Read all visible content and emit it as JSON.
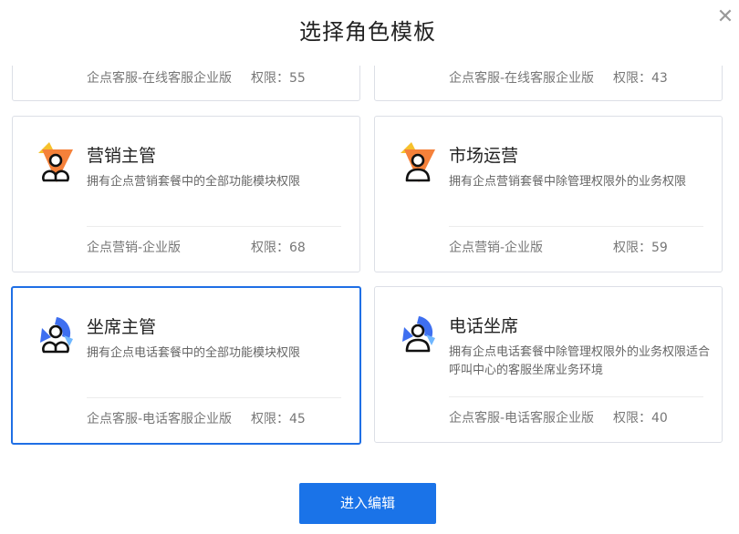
{
  "dialog": {
    "title": "选择角色模板",
    "close_glyph": "✕"
  },
  "cards": [
    {
      "name": "",
      "desc": "",
      "product": "企点客服-在线客服企业版",
      "perm": "权限：55",
      "icon": "none",
      "partial": true
    },
    {
      "name": "",
      "desc": "",
      "product": "企点客服-在线客服企业版",
      "perm": "权限：43",
      "icon": "none",
      "partial": true
    },
    {
      "name": "营销主管",
      "desc": "拥有企点营销套餐中的全部功能模块权限",
      "product": "企点营销-企业版",
      "perm": "权限：68",
      "icon": "marketing-manager-icon"
    },
    {
      "name": "市场运营",
      "desc": "拥有企点营销套餐中除管理权限外的业务权限",
      "product": "企点营销-企业版",
      "perm": "权限：59",
      "icon": "marketing-operator-icon"
    },
    {
      "name": "坐席主管",
      "desc": "拥有企点电话套餐中的全部功能模块权限",
      "product": "企点客服-电话客服企业版",
      "perm": "权限：45",
      "icon": "seat-manager-icon",
      "selected": true
    },
    {
      "name": "电话坐席",
      "desc": "拥有企点电话套餐中除管理权限外的业务权限适合呼叫中心的客服坐席业务环境",
      "product": "企点客服-电话客服企业版",
      "perm": "权限：40",
      "icon": "phone-seat-icon"
    }
  ],
  "footer": {
    "enter_label": "进入编辑"
  },
  "colors": {
    "accent": "#1a73e8",
    "selected_border": "#1f6fe5",
    "icon_orange": "#f5813a",
    "icon_yellow": "#f6c12c",
    "icon_blue": "#3e6ff0",
    "icon_lightblue": "#6fb7ff"
  }
}
